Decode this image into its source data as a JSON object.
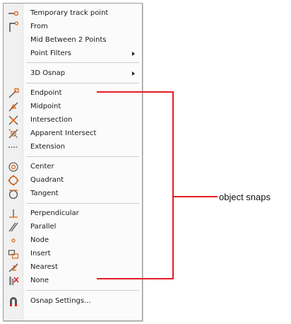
{
  "menu": {
    "items": [
      {
        "label": "Temporary track point",
        "icon": "temporary-track-point-icon"
      },
      {
        "label": "From",
        "icon": "from-icon"
      },
      {
        "label": "Mid Between 2 Points",
        "icon": ""
      },
      {
        "label": "Point Filters",
        "icon": "",
        "submenu": true
      },
      {
        "label": "3D Osnap",
        "icon": "",
        "submenu": true
      },
      {
        "label": "Endpoint",
        "icon": "endpoint-icon"
      },
      {
        "label": "Midpoint",
        "icon": "midpoint-icon"
      },
      {
        "label": "Intersection",
        "icon": "intersection-icon"
      },
      {
        "label": "Apparent Intersect",
        "icon": "apparent-intersect-icon"
      },
      {
        "label": "Extension",
        "icon": "extension-icon"
      },
      {
        "label": "Center",
        "icon": "center-icon"
      },
      {
        "label": "Quadrant",
        "icon": "quadrant-icon"
      },
      {
        "label": "Tangent",
        "icon": "tangent-icon"
      },
      {
        "label": "Perpendicular",
        "icon": "perpendicular-icon"
      },
      {
        "label": "Parallel",
        "icon": "parallel-icon"
      },
      {
        "label": "Node",
        "icon": "node-icon"
      },
      {
        "label": "Insert",
        "icon": "insert-icon"
      },
      {
        "label": "Nearest",
        "icon": "nearest-icon"
      },
      {
        "label": "None",
        "icon": "none-icon"
      },
      {
        "label": "Osnap Settings...",
        "icon": "osnap-settings-icon"
      }
    ]
  },
  "annotation": {
    "label": "object snaps",
    "color": "#e41d23"
  }
}
